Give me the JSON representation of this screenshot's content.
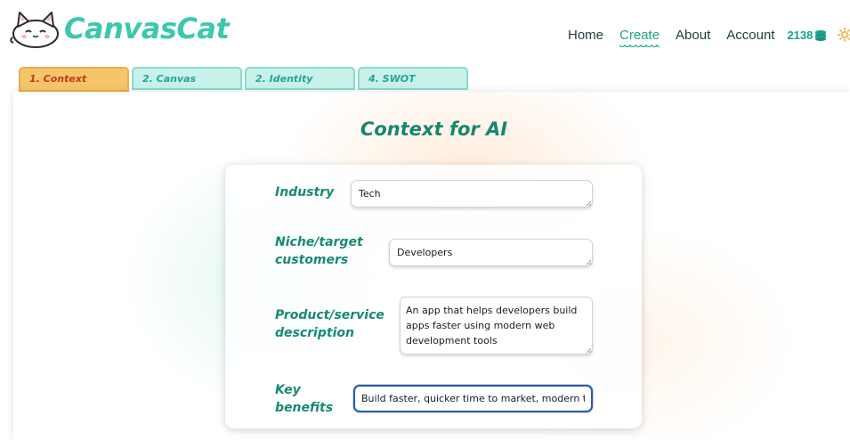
{
  "app": {
    "title": "CanvasCat"
  },
  "nav": {
    "items": [
      {
        "label": "Home",
        "active": false
      },
      {
        "label": "Create",
        "active": true
      },
      {
        "label": "About",
        "active": false
      },
      {
        "label": "Account",
        "active": false
      }
    ],
    "credits": "2138",
    "credits_icon": "coin-stack-icon",
    "theme_icon": "sun-icon"
  },
  "tabs": [
    {
      "label": "1. Context",
      "active": true
    },
    {
      "label": "2. Canvas",
      "active": false
    },
    {
      "label": "2. Identity",
      "active": false
    },
    {
      "label": "4. SWOT",
      "active": false
    }
  ],
  "page": {
    "title": "Context for AI"
  },
  "form": {
    "industry": {
      "label": "Industry",
      "value": "Tech"
    },
    "niche": {
      "label_line1": "Niche/target",
      "label_line2": "customers",
      "value": "Developers"
    },
    "product": {
      "label_line1": "Product/service",
      "label_line2": "description",
      "value": "An app that helps developers build apps faster using modern web development tools"
    },
    "benefits": {
      "label_line1": "Key",
      "label_line2": "benefits",
      "value": "Build faster, quicker time to market, modern tools"
    }
  },
  "colors": {
    "brand": "#3ec7ad",
    "label": "#168a73",
    "active_tab": "#f6c56a",
    "active_tab_text": "#c23a1a",
    "inactive_tab": "#c8f1ea",
    "focus": "#2a5aa8"
  }
}
